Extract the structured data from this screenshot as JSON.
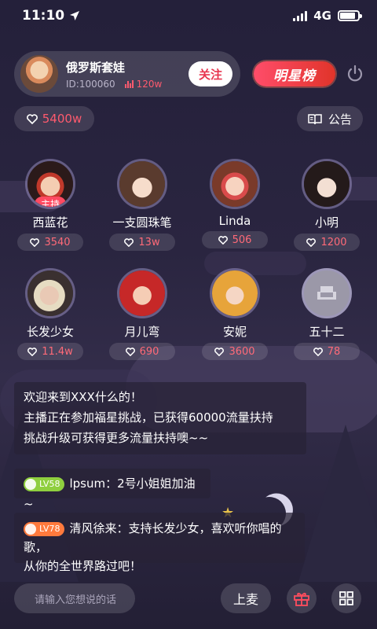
{
  "status": {
    "time": "11:10",
    "network": "4G"
  },
  "host": {
    "name": "俄罗斯套娃",
    "id": "ID:100060",
    "heat": "120w",
    "follow_label": "关注"
  },
  "rank_label": "明星榜",
  "room_heat": "5400w",
  "notice_label": "公告",
  "seats": [
    {
      "name": "西蓝花",
      "heat": "3540",
      "tag": "主持"
    },
    {
      "name": "一支圆珠笔",
      "heat": "13w"
    },
    {
      "name": "Linda",
      "heat": "506"
    },
    {
      "name": "小明",
      "heat": "1200"
    },
    {
      "name": "长发少女",
      "heat": "11.4w"
    },
    {
      "name": "月儿弯",
      "heat": "690"
    },
    {
      "name": "安妮",
      "heat": "3600"
    },
    {
      "name": "五十二",
      "heat": "78"
    }
  ],
  "welcome": {
    "line1": "欢迎来到XXX什么的！",
    "line2": "主播正在参加福星挑战，已获得60000流量扶持",
    "line3": "挑战升级可获得更多流量扶持噢~~"
  },
  "messages": [
    {
      "level": "LV58",
      "user": "lpsum：",
      "text": "2号小姐姐加油~",
      "badge_color": "#8fcf3f"
    },
    {
      "level": "LV78",
      "user": "清风徐来：",
      "text": "支持长发少女，喜欢听你唱的歌，",
      "text2": "从你的全世界路过吧！",
      "badge_color": "#ff7a3d"
    }
  ],
  "input_placeholder": "请输入您想说的话",
  "mic_label": "上麦",
  "icons": [
    "location-arrow-icon",
    "signal-icon",
    "battery-icon",
    "heat-bars-icon",
    "power-icon",
    "heart-icon",
    "book-icon",
    "gift-icon",
    "grid-icon",
    "sofa-icon"
  ]
}
